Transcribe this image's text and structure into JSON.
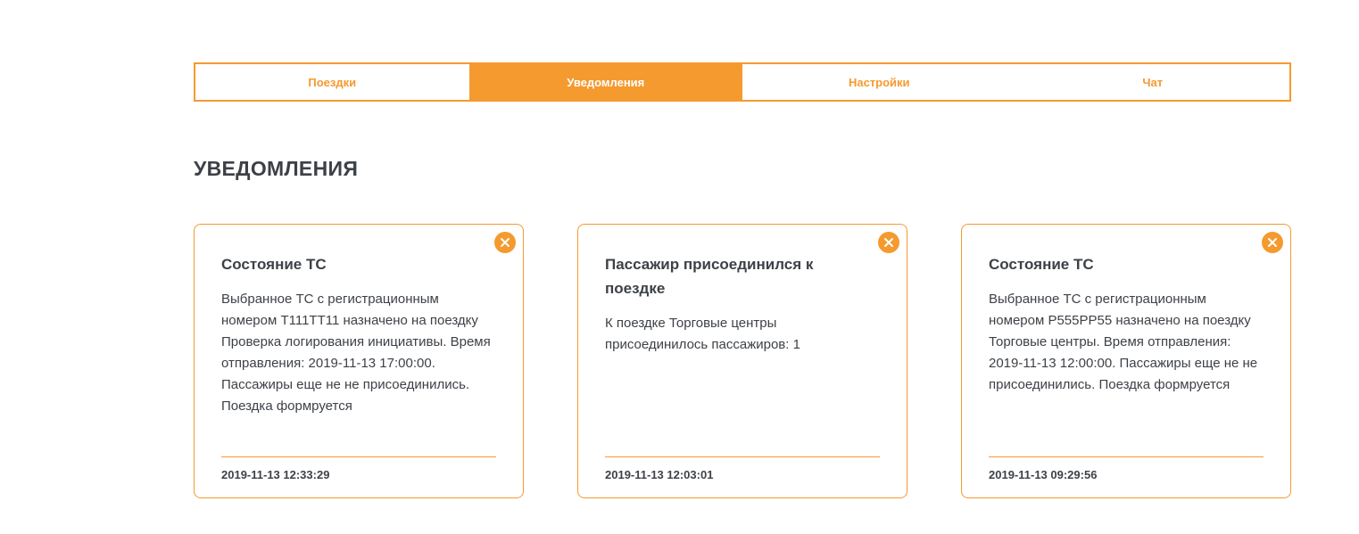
{
  "tabs": [
    {
      "label": "Поездки",
      "active": false
    },
    {
      "label": "Уведомления",
      "active": true
    },
    {
      "label": "Настройки",
      "active": false
    },
    {
      "label": "Чат",
      "active": false
    }
  ],
  "page_title": "УВЕДОМЛЕНИЯ",
  "colors": {
    "accent": "#f59a2f",
    "text": "#3d4147",
    "background": "#ffffff"
  },
  "notifications": [
    {
      "title": "Состояние ТС",
      "text": "Выбранное ТС с регистрационным номером Т111ТТ11 назначено на поездку Проверка логирования инициативы. Время отправления: 2019-11-13 17:00:00. Пассажиры еще не не присоединились. Поездка формруется",
      "date": "2019-11-13 12:33:29",
      "close_icon": "close-icon"
    },
    {
      "title": "Пассажир присоединился к поездке",
      "text": "К поездке Торговые центры присоединилось пассажиров: 1",
      "date": "2019-11-13 12:03:01",
      "close_icon": "close-icon"
    },
    {
      "title": "Состояние ТС",
      "text": "Выбранное ТС с регистрационным номером Р555РР55 назначено на поездку Торговые центры. Время отправления: 2019-11-13 12:00:00. Пассажиры еще не не присоединились. Поездка формруется",
      "date": "2019-11-13 09:29:56",
      "close_icon": "close-icon"
    }
  ]
}
